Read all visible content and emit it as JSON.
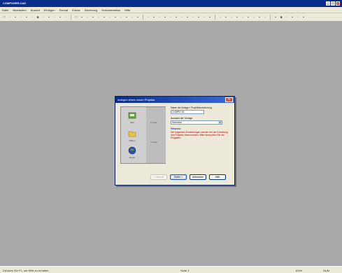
{
  "window": {
    "title": "COMPOSER.CAD",
    "minimize": "_",
    "maximize": "□",
    "close": "x"
  },
  "menu": [
    "Datei",
    "Bearbeiten",
    "Ansicht",
    "Einfügen",
    "Format",
    "Extras",
    "Zeichnung",
    "Dokumentation",
    "Hilfe"
  ],
  "toolbar": {
    "buttons": [
      "□",
      "▫",
      "▪",
      "▫",
      "▪",
      "▫",
      "■",
      "▫",
      "▪",
      "▫",
      "▪",
      "▫",
      "□",
      "▪",
      "▫",
      "▪",
      "▫",
      "▪",
      "▫",
      "▪",
      "▫",
      "▪",
      "▫",
      "▪",
      "▫",
      "▪",
      "▫",
      "▪",
      "▫",
      "▪",
      "▫",
      "▪",
      "▫",
      "▪",
      "▫",
      "▪",
      "▫",
      "▪",
      "▫",
      "▪",
      "▫",
      "▪",
      "▫",
      "▪",
      "▫",
      "▪",
      "■",
      "▫",
      "▪",
      "▫",
      "▪"
    ]
  },
  "dialog": {
    "title": "Anlegen eines neuen Projekts",
    "close": "x",
    "options": [
      "Neu",
      "Öffnen",
      "Import"
    ],
    "panel_labels": [
      "Projekt",
      "Vorlage"
    ],
    "name_label": "Name der Anlage / Projektbezeichnung",
    "name_value": "COMPO 01",
    "template_label": "Auswahl der Vorlage",
    "template_value": "Standard",
    "hint_title": "Hinweis:",
    "hint_text": "Die folgenden Einstellungen werden bei der Erstellung des Projekts übernommen. Bitte überprüfen Sie die Eingaben.",
    "buttons": {
      "back": "< Zurück",
      "next": "Weiter >",
      "cancel": "Abbrechen",
      "help": "Hilfe"
    }
  },
  "statusbar": {
    "left": "Drücken Sie F1, um Hilfe zu erhalten.",
    "center": "Seite 1",
    "zoom": "100%",
    "right": "NUM"
  }
}
